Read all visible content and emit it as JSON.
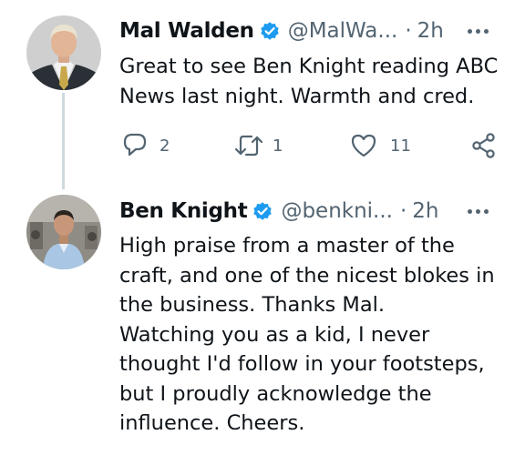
{
  "tweets": [
    {
      "name": "Mal Walden",
      "handle": "@MalWa...",
      "separator": "·",
      "time": "2h",
      "text_lines": [
        "Great to see Ben Knight reading ABC",
        "News last night. Warmth and cred."
      ],
      "actions": {
        "replies": "2",
        "retweets": "1",
        "likes": "11"
      }
    },
    {
      "name": "Ben Knight",
      "handle": "@benkni...",
      "separator": "·",
      "time": "2h",
      "text_lines": [
        "High praise from a master of the",
        "craft, and one of the nicest blokes in",
        "the business.  Thanks Mal.",
        "Watching you as a kid, I never",
        "thought I'd follow in your footsteps,",
        "but I proudly acknowledge the",
        "influence.  Cheers."
      ]
    }
  ],
  "colors": {
    "verified": "#1d9bf0",
    "text": "#0f1419",
    "muted": "#536471",
    "thread_line": "#cfd9de"
  },
  "icons": [
    "reply-icon",
    "retweet-icon",
    "like-icon",
    "share-icon",
    "verified-badge-icon",
    "more-icon"
  ]
}
